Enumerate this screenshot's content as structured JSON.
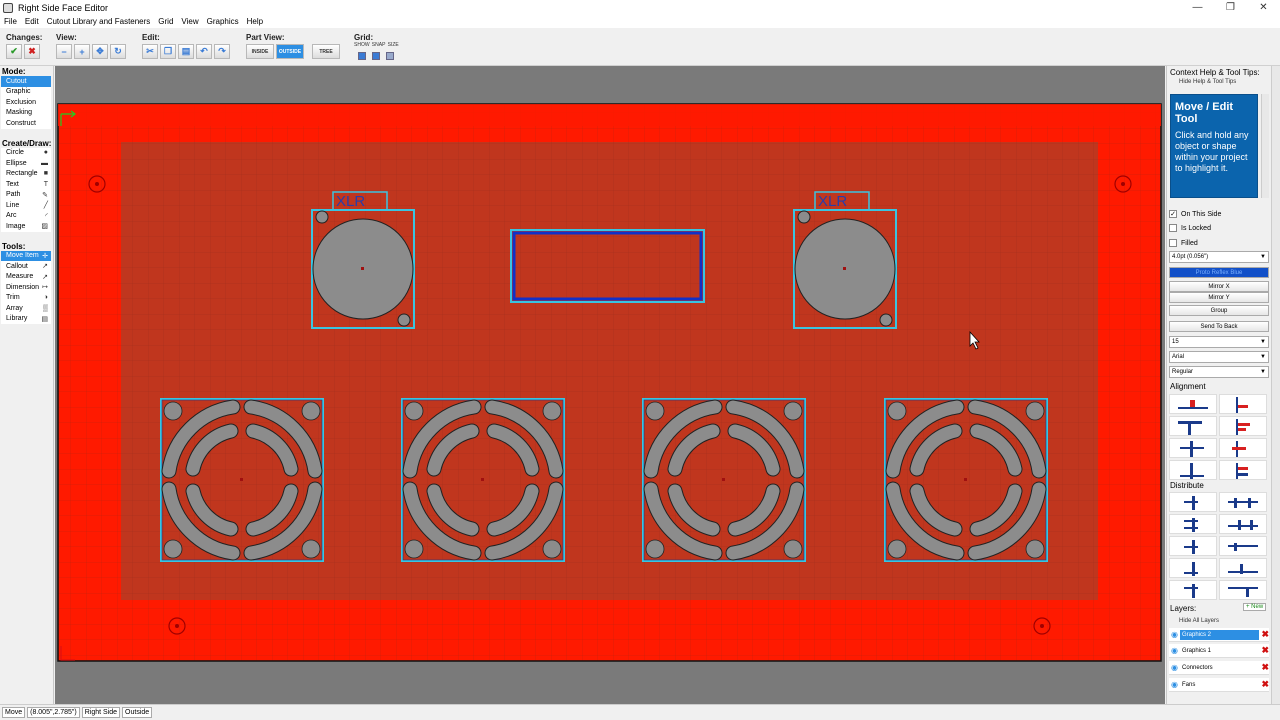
{
  "window": {
    "title": "Right Side Face Editor",
    "minimize": "—",
    "maximize": "❐",
    "close": "✕"
  },
  "menu": [
    "File",
    "Edit",
    "Cutout Library and Fasteners",
    "Grid",
    "View",
    "Graphics",
    "Help"
  ],
  "toolbar": {
    "changes_label": "Changes:",
    "view_label": "View:",
    "edit_label": "Edit:",
    "partview_label": "Part View:",
    "partview_inside": "INSIDE",
    "partview_outside": "OUTSIDE",
    "partview_tree": "TREE",
    "grid_label": "Grid:",
    "grid_show": "SHOW",
    "grid_snap": "SNAP",
    "grid_size": "SIZE"
  },
  "left": {
    "mode_label": "Mode:",
    "modes": [
      "Cutout",
      "Graphic",
      "Exclusion",
      "Masking",
      "Construct"
    ],
    "create_label": "Create/Draw:",
    "create": [
      {
        "label": "Circle",
        "icon": "●"
      },
      {
        "label": "Ellipse",
        "icon": "▬"
      },
      {
        "label": "Rectangle",
        "icon": "■"
      },
      {
        "label": "Text",
        "icon": "T"
      },
      {
        "label": "Path",
        "icon": "✎"
      },
      {
        "label": "Line",
        "icon": "╱"
      },
      {
        "label": "Arc",
        "icon": "◜"
      },
      {
        "label": "Image",
        "icon": "▨"
      }
    ],
    "tools_label": "Tools:",
    "tools": [
      {
        "label": "Move Item",
        "icon": "✛"
      },
      {
        "label": "Callout",
        "icon": "↗"
      },
      {
        "label": "Measure",
        "icon": "↗"
      },
      {
        "label": "Dimension",
        "icon": "↦"
      },
      {
        "label": "Trim",
        "icon": "◑"
      },
      {
        "label": "Array",
        "icon": "▒"
      },
      {
        "label": "Library",
        "icon": "▤"
      }
    ]
  },
  "panel": {
    "context_title": "Context Help & Tool Tips:",
    "hide_help": "Hide Help & Tool Tips",
    "help_heading": "Move / Edit Tool",
    "help_text": "Click and hold any object or shape within your project to highlight it.",
    "on_this_side": "On This Side",
    "is_locked": "Is Locked",
    "filled": "Filled",
    "stroke": "4.0pt (0.056\")",
    "color_button": "Proto Reflex Blue",
    "mirror_x": "Mirror X",
    "mirror_y": "Mirror Y",
    "group": "Group",
    "send_back": "Send To Back",
    "font_size": "15",
    "font_name": "Arial",
    "font_style": "Regular",
    "alignment": "Alignment",
    "distribute": "Distribute",
    "layers_label": "Layers:",
    "new_layer": "+ New",
    "hide_layers": "Hide All Layers",
    "layers": [
      "Graphics 2",
      "Graphics 1",
      "Connectors",
      "Fans"
    ]
  },
  "canvas": {
    "xlr_label": "XLR"
  },
  "status": [
    "Move",
    "(8.005\",2.785\")",
    "Right Side",
    "Outside"
  ]
}
